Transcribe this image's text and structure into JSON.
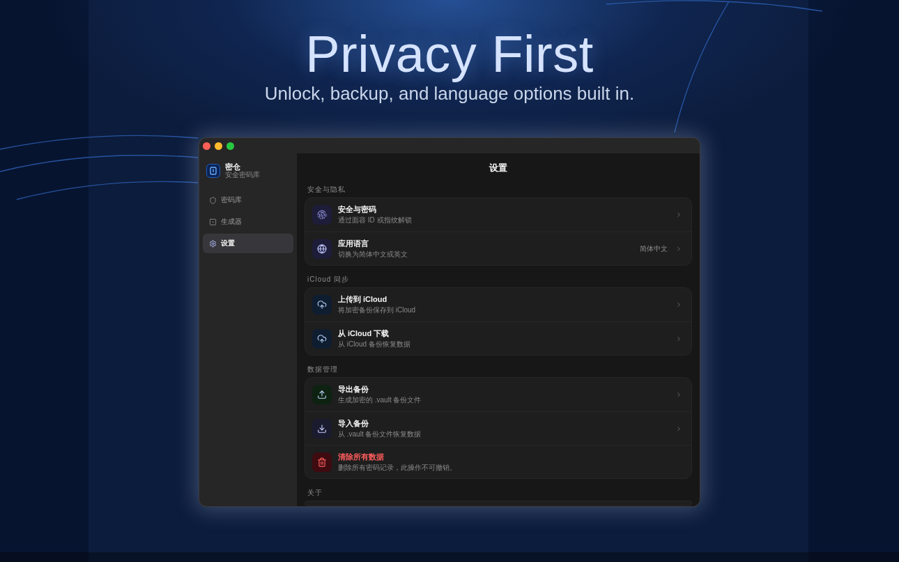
{
  "headline": "Privacy First",
  "tagline": "Unlock, backup, and language options built in.",
  "window": {
    "sidebar": {
      "app_name": "密仓",
      "app_subtitle": "安全密码库",
      "items": [
        {
          "label": "密码库",
          "selected": false
        },
        {
          "label": "生成器",
          "selected": false
        },
        {
          "label": "设置",
          "selected": true
        }
      ]
    },
    "main": {
      "title": "设置",
      "sections": [
        {
          "label": "安全与隐私",
          "rows": [
            {
              "kind": "link",
              "title": "安全与密码",
              "subtitle": "通过面容 ID 或指纹解锁",
              "color": "#1d1d3a"
            },
            {
              "kind": "link",
              "title": "应用语言",
              "subtitle": "切换为简体中文或英文",
              "value": "简体中文",
              "color": "#1d1d3a"
            }
          ]
        },
        {
          "label": "iCloud 同步",
          "rows": [
            {
              "kind": "link",
              "title": "上传到 iCloud",
              "subtitle": "将加密备份保存到 iCloud",
              "color": "#0f1d31"
            },
            {
              "kind": "link",
              "title": "从 iCloud 下载",
              "subtitle": "从 iCloud 备份恢复数据",
              "color": "#0f1d31"
            }
          ]
        },
        {
          "label": "数据管理",
          "rows": [
            {
              "kind": "link",
              "title": "导出备份",
              "subtitle": "生成加密的 .vault 备份文件",
              "color": "#0e2212"
            },
            {
              "kind": "link",
              "title": "导入备份",
              "subtitle": "从 .vault 备份文件恢复数据",
              "color": "#1a1b2f"
            },
            {
              "kind": "danger",
              "title": "清除所有数据",
              "subtitle": "删除所有密码记录，此操作不可撤销。",
              "color": "#3e0b10"
            }
          ]
        },
        {
          "label": "关于"
        }
      ]
    }
  }
}
